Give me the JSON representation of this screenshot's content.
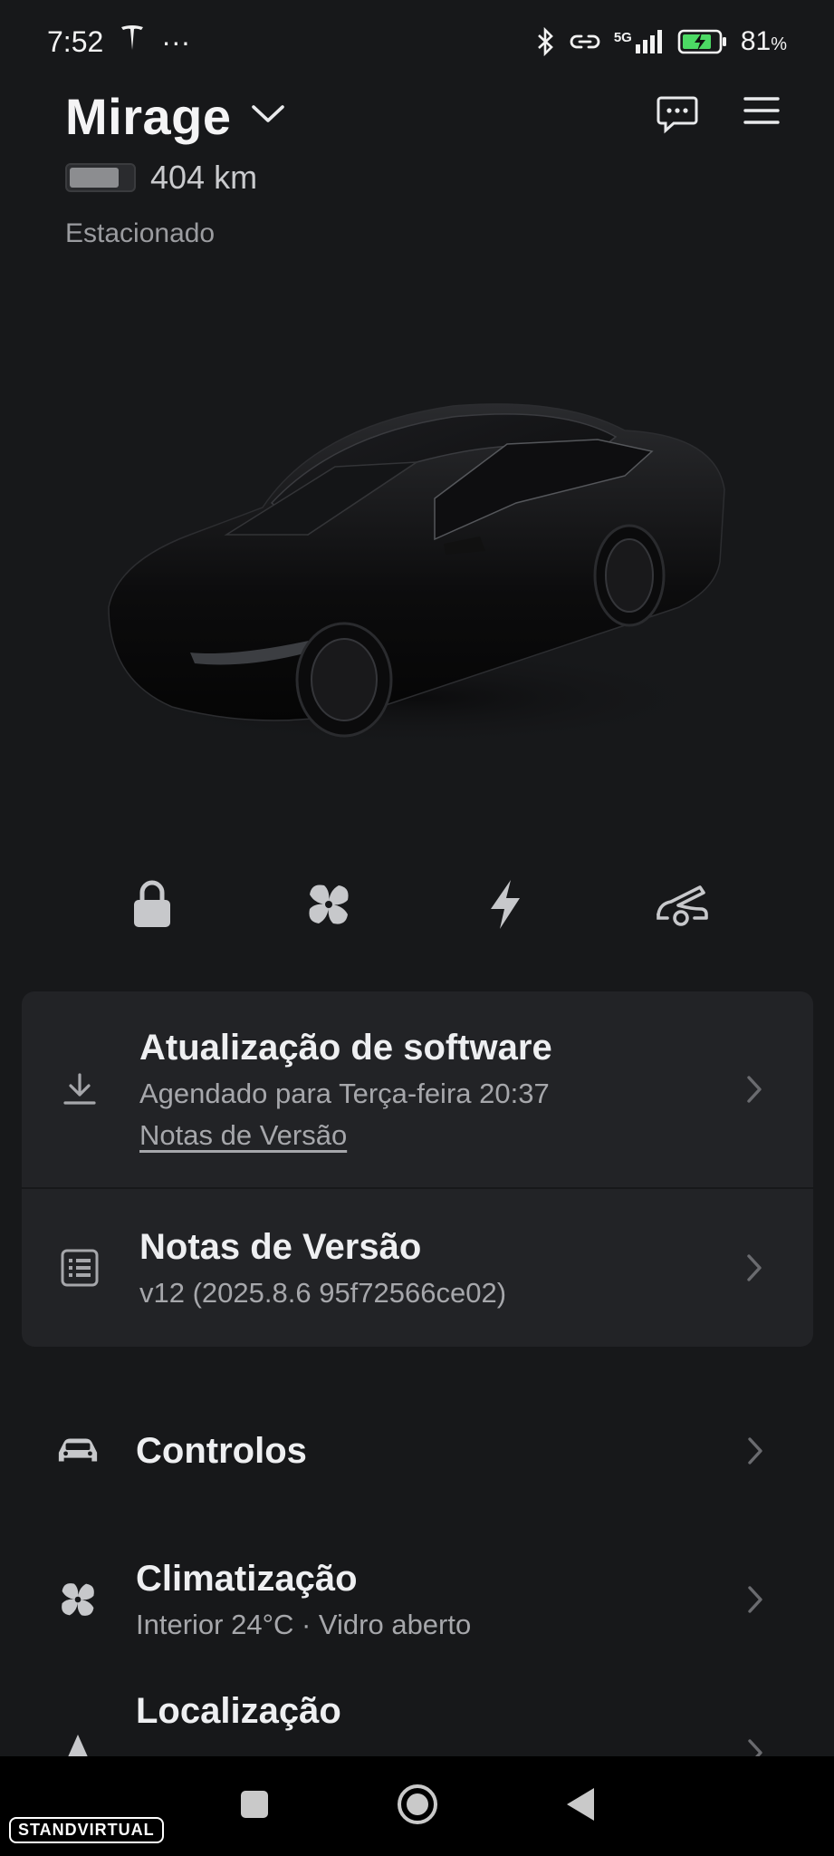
{
  "status_bar": {
    "time": "7:52",
    "more": "···",
    "network": "5G",
    "battery_percent": "81",
    "percent_sign": "%",
    "icons": [
      "tesla-logo-icon",
      "bluetooth-icon",
      "link-icon",
      "signal-icon",
      "battery-charging-icon"
    ]
  },
  "header": {
    "vehicle_name": "Mirage",
    "range": "404 km",
    "state": "Estacionado",
    "battery_level": 0.81
  },
  "quick_controls": [
    {
      "icon": "lock-icon"
    },
    {
      "icon": "fan-icon"
    },
    {
      "icon": "charge-icon"
    },
    {
      "icon": "frunk-icon"
    }
  ],
  "software_card": {
    "update": {
      "title": "Atualização de software",
      "subtitle": "Agendado para Terça-feira 20:37",
      "link": "Notas de Versão"
    },
    "release_notes": {
      "title": "Notas de Versão",
      "subtitle": "v12 (2025.8.6 95f72566ce02)"
    }
  },
  "menu": {
    "controls": {
      "title": "Controlos"
    },
    "climate": {
      "title": "Climatização",
      "subtitle": "Interior 24°C · Vidro aberto"
    },
    "location": {
      "title": "Localização"
    }
  },
  "watermark": "STANDVIRTUAL",
  "colors": {
    "background": "#17181a",
    "card": "#222326",
    "text": "#e9eaec",
    "subtext": "#a6a7ab",
    "battery_green": "#4cd964"
  }
}
